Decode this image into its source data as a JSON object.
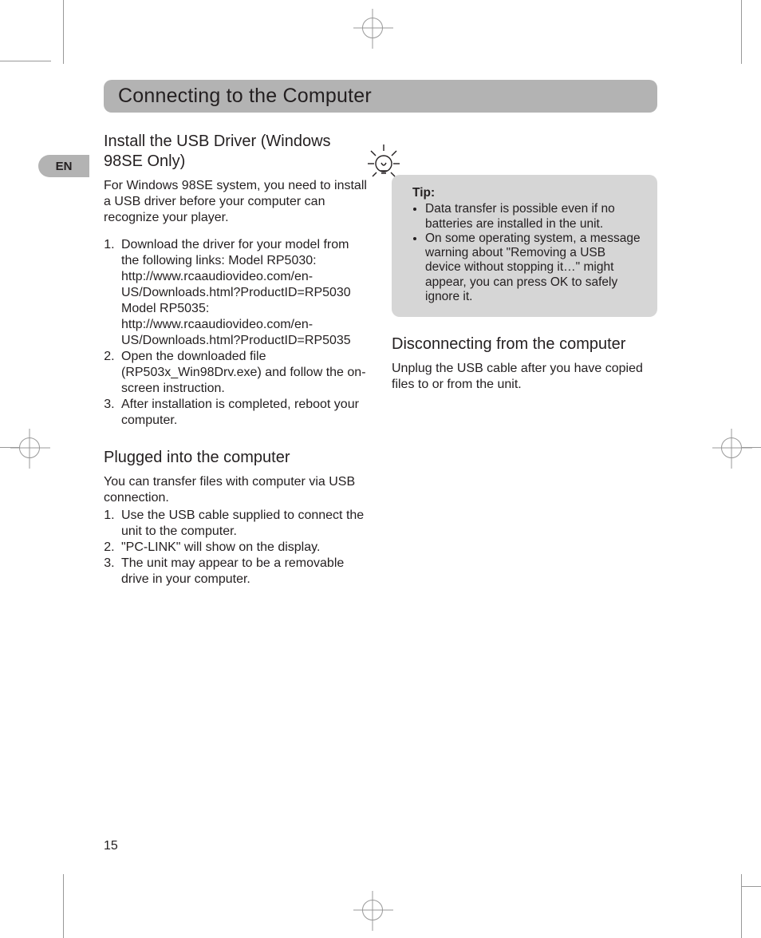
{
  "lang_tab": "EN",
  "section_title": "Connecting to the Computer",
  "page_number": "15",
  "col1": {
    "h1": "Install the USB Driver (Windows 98SE Only)",
    "p1": "For Windows 98SE system, you need to install a USB driver before your computer can recognize your player.",
    "ol1": [
      "Download the driver for your model from the following links: Model RP5030: http://www.rcaaudiovideo.com/en-US/Downloads.html?ProductID=RP5030 Model RP5035: http://www.rcaaudiovideo.com/en-US/Downloads.html?ProductID=RP5035",
      "Open the downloaded file (RP503x_Win98Drv.exe) and follow the on-screen instruction.",
      "After installation is completed, reboot your computer."
    ],
    "h2": "Plugged into the computer",
    "p2": "You can transfer files with computer via USB connection.",
    "ol2": [
      "Use the USB cable supplied to connect the unit to the computer.",
      "\"PC-LINK\" will show on the display.",
      "The unit may appear to be a removable drive in your computer."
    ]
  },
  "col2": {
    "tip_label": "Tip:",
    "tips": [
      "Data transfer is possible even if no batteries are installed in the unit.",
      "On some operating system, a message warning about \"Removing a USB device without stopping it…\" might appear, you can press OK to safely ignore it."
    ],
    "h1": "Disconnecting from the computer",
    "p1": "Unplug the USB cable after you have copied files to or from the unit."
  }
}
